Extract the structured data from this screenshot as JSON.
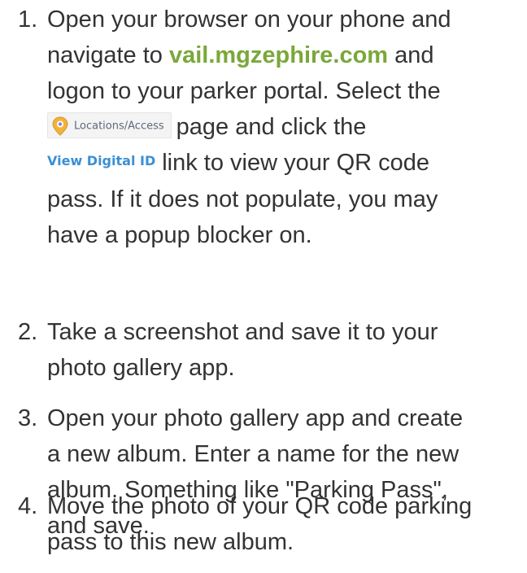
{
  "steps": [
    {
      "number": "1.",
      "line1": "Open your browser on your phone and",
      "line2_a": "navigate to ",
      "link": "vail.mgzephire.com",
      "line2_b": " and",
      "line3": "logon to your parker portal.  Select the",
      "locations_button": "Locations/Access",
      "line4": "page and click the",
      "view_digital_id": "View Digital ID",
      "line5": "link to view your QR code",
      "line6": "pass.  If it does not populate, you may",
      "line7": "have a popup blocker on."
    },
    {
      "number": "2.",
      "line1": "Take a screenshot and save it to your",
      "line2": "photo gallery app."
    },
    {
      "number": "3.",
      "line1": "Open your photo gallery app and create",
      "line2": "a new album.  Enter a name for the new",
      "line3": "album.  Something like \"Parking Pass\",",
      "line4": "and save."
    },
    {
      "number": "4.",
      "line1": "Move the photo of your QR code parking",
      "line2": "pass to this new album."
    }
  ],
  "colors": {
    "text": "#333333",
    "link": "#7aa83a",
    "view_digital_id": "#3b8fd4",
    "pin": "#f0b43a"
  },
  "icons": {
    "locations": "map-pin-icon"
  }
}
